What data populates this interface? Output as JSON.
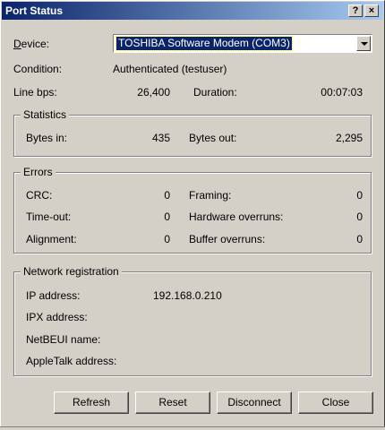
{
  "window": {
    "title": "Port Status",
    "help_label": "?",
    "close_label": "×"
  },
  "device": {
    "label": "Device:",
    "value": "TOSHIBA Software Modem (COM3)"
  },
  "condition": {
    "label": "Condition:",
    "value": "Authenticated (testuser)"
  },
  "line": {
    "label": "Line bps:",
    "value": "26,400",
    "duration_label": "Duration:",
    "duration_value": "00:07:03"
  },
  "statistics": {
    "title": "Statistics",
    "bytes_in_label": "Bytes in:",
    "bytes_in": "435",
    "bytes_out_label": "Bytes out:",
    "bytes_out": "2,295"
  },
  "errors": {
    "title": "Errors",
    "crc_label": "CRC:",
    "crc": "0",
    "timeout_label": "Time-out:",
    "timeout": "0",
    "alignment_label": "Alignment:",
    "alignment": "0",
    "framing_label": "Framing:",
    "framing": "0",
    "hw_overruns_label": "Hardware overruns:",
    "hw_overruns": "0",
    "buf_overruns_label": "Buffer overruns:",
    "buf_overruns": "0"
  },
  "network": {
    "title": "Network registration",
    "ip_label": "IP address:",
    "ip": "192.168.0.210",
    "ipx_label": "IPX address:",
    "netbeui_label": "NetBEUI name:",
    "appletalk_label": "AppleTalk address:"
  },
  "buttons": {
    "refresh": "Refresh",
    "reset": "Reset",
    "disconnect": "Disconnect",
    "close": "Close"
  }
}
